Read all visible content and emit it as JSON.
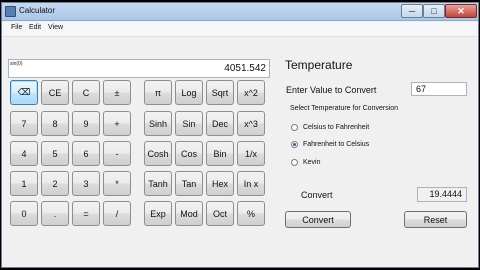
{
  "window": {
    "title": "Calculator",
    "minimize_label": "─",
    "maximize_label": "□",
    "close_label": "✕"
  },
  "menu": [
    "File",
    "Edit",
    "View"
  ],
  "calculator": {
    "expression": "sin(0)",
    "display_value": "4051.542",
    "keys": [
      [
        "⌫",
        "CE",
        "C",
        "±",
        "π",
        "Log",
        "Sqrt",
        "x^2"
      ],
      [
        "7",
        "8",
        "9",
        "+",
        "Sinh",
        "Sin",
        "Dec",
        "x^3"
      ],
      [
        "4",
        "5",
        "6",
        "-",
        "Cosh",
        "Cos",
        "Bin",
        "1/x"
      ],
      [
        "1",
        "2",
        "3",
        "*",
        "Tanh",
        "Tan",
        "Hex",
        "In x"
      ],
      [
        "0",
        ".",
        "=",
        "/",
        "Exp",
        "Mod",
        "Oct",
        "%"
      ]
    ]
  },
  "temperature": {
    "title": "Temperature",
    "enter_label": "Enter Value to Convert",
    "input_value": "67",
    "group_label": "Select Temperature for Conversion",
    "options": [
      "Celsius to Fahrenheit",
      "Fahrenheit to Celsius",
      "Kevin"
    ],
    "selected_option": "Fahrenheit to Celsius",
    "convert_label": "Convert",
    "result_value": "19.4444",
    "convert_button": "Convert",
    "reset_button": "Reset"
  }
}
